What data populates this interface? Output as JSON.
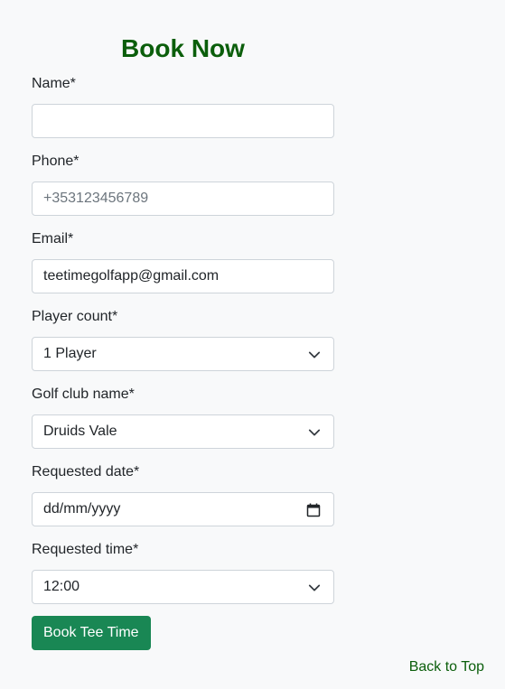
{
  "title": "Book Now",
  "form": {
    "name": {
      "label": "Name*",
      "value": ""
    },
    "phone": {
      "label": "Phone*",
      "placeholder": "+353123456789"
    },
    "email": {
      "label": "Email*",
      "value": "teetimegolfapp@gmail.com"
    },
    "player_count": {
      "label": "Player count*",
      "selected": "1 Player"
    },
    "golf_club": {
      "label": "Golf club name*",
      "selected": "Druids Vale"
    },
    "requested_date": {
      "label": "Requested date*",
      "placeholder": "dd/mm/yyyy"
    },
    "requested_time": {
      "label": "Requested time*",
      "selected": "12:00"
    },
    "submit_label": "Book Tee Time"
  },
  "back_to_top": "Back to Top",
  "colors": {
    "title": "#0b5e0b",
    "button": "#198754",
    "link": "#0b5e0b",
    "background": "#f8f9fa"
  }
}
